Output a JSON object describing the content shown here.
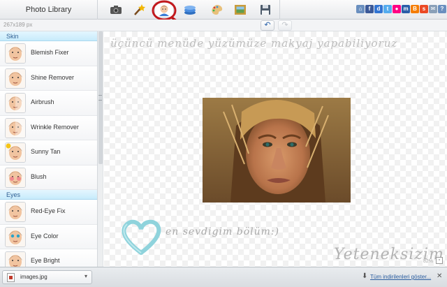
{
  "app": {
    "title": "Photo Library",
    "image_dims": "267x189 px"
  },
  "toolbar": {
    "tools": [
      {
        "icon": "camera-icon",
        "active": false
      },
      {
        "icon": "magic-wand-icon",
        "active": false
      },
      {
        "icon": "face-touchup-icon",
        "active": true
      },
      {
        "icon": "layers-icon",
        "active": false
      },
      {
        "icon": "palette-icon",
        "active": false
      },
      {
        "icon": "frame-icon",
        "active": false
      },
      {
        "icon": "save-icon",
        "active": false
      }
    ],
    "social": [
      {
        "icon": "home-icon",
        "glyph": "⌂",
        "color": "#6a8fbf"
      },
      {
        "icon": "facebook-icon",
        "glyph": "f",
        "color": "#3b5998"
      },
      {
        "icon": "delicious-icon",
        "glyph": "d",
        "color": "#3274d2"
      },
      {
        "icon": "twitter-icon",
        "glyph": "t",
        "color": "#55acee"
      },
      {
        "icon": "flickr-icon",
        "glyph": "●",
        "color": "#ff0084"
      },
      {
        "icon": "myspace-icon",
        "glyph": "m",
        "color": "#2b5ea8"
      },
      {
        "icon": "blogger-icon",
        "glyph": "B",
        "color": "#f57d00"
      },
      {
        "icon": "stumbleupon-icon",
        "glyph": "s",
        "color": "#eb4924"
      },
      {
        "icon": "mail-icon",
        "glyph": "✉",
        "color": "#8aa0b8"
      },
      {
        "icon": "help-icon",
        "glyph": "?",
        "color": "#6a8fbf"
      }
    ]
  },
  "panel": {
    "sections": [
      {
        "title": "Skin",
        "items": [
          {
            "label": "Blemish Fixer",
            "icon": "blemish-fixer-icon",
            "mark": "none"
          },
          {
            "label": "Shine Remover",
            "icon": "shine-remover-icon",
            "mark": "none"
          },
          {
            "label": "Airbrush",
            "icon": "airbrush-icon",
            "mark": "split"
          },
          {
            "label": "Wrinkle Remover",
            "icon": "wrinkle-remover-icon",
            "mark": "split"
          },
          {
            "label": "Sunny Tan",
            "icon": "sunny-tan-icon",
            "mark": "sun"
          },
          {
            "label": "Blush",
            "icon": "blush-icon",
            "mark": "blush"
          }
        ]
      },
      {
        "title": "Eyes",
        "items": [
          {
            "label": "Red-Eye Fix",
            "icon": "red-eye-fix-icon",
            "mark": "none"
          },
          {
            "label": "Eye Color",
            "icon": "eye-color-icon",
            "mark": "eyes"
          },
          {
            "label": "Eye Bright",
            "icon": "eye-bright-icon",
            "mark": "none"
          }
        ]
      }
    ]
  },
  "canvas": {
    "caption": "üçüncü menüde yüzümüze makyaj yapabiliyoruz",
    "love_text": "en sevdigim bölüm:)",
    "signature": "Yeteneksizim",
    "zoom": "82%"
  },
  "downloads": {
    "file_name": "images.jpg",
    "show_all": "Tüm indirilenleri göster..."
  },
  "colors": {
    "accent_ring": "#c2191d",
    "section_head": "#c7ebfb",
    "heart": "#8fd3dc"
  }
}
